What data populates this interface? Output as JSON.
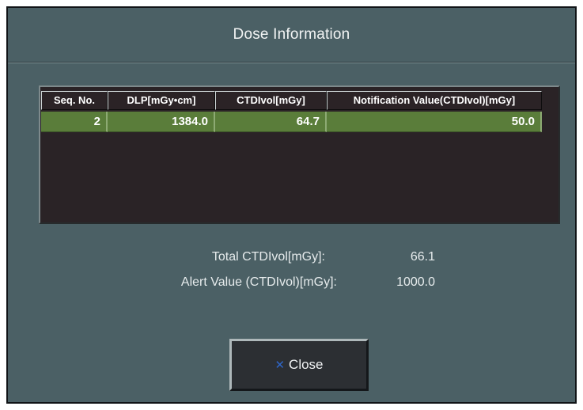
{
  "dialog": {
    "title": "Dose Information"
  },
  "table": {
    "headers": [
      "Seq. No.",
      "DLP[mGy•cm]",
      "CTDIvol[mGy]",
      "Notification Value(CTDIvol)[mGy]"
    ],
    "rows": [
      [
        "2",
        "1384.0",
        "64.7",
        "50.0"
      ]
    ]
  },
  "summary": {
    "total_label": "Total CTDIvol[mGy]:",
    "total_value": "66.1",
    "alert_label": "Alert Value (CTDIvol)[mGy]:",
    "alert_value": "1000.0"
  },
  "buttons": {
    "close_label": "Close",
    "close_icon": "close-icon"
  },
  "colors": {
    "dialog_background": "#4b6065",
    "table_background": "#2a2326",
    "selected_row": "#5a7d3a",
    "close_icon": "#2f66c9"
  }
}
